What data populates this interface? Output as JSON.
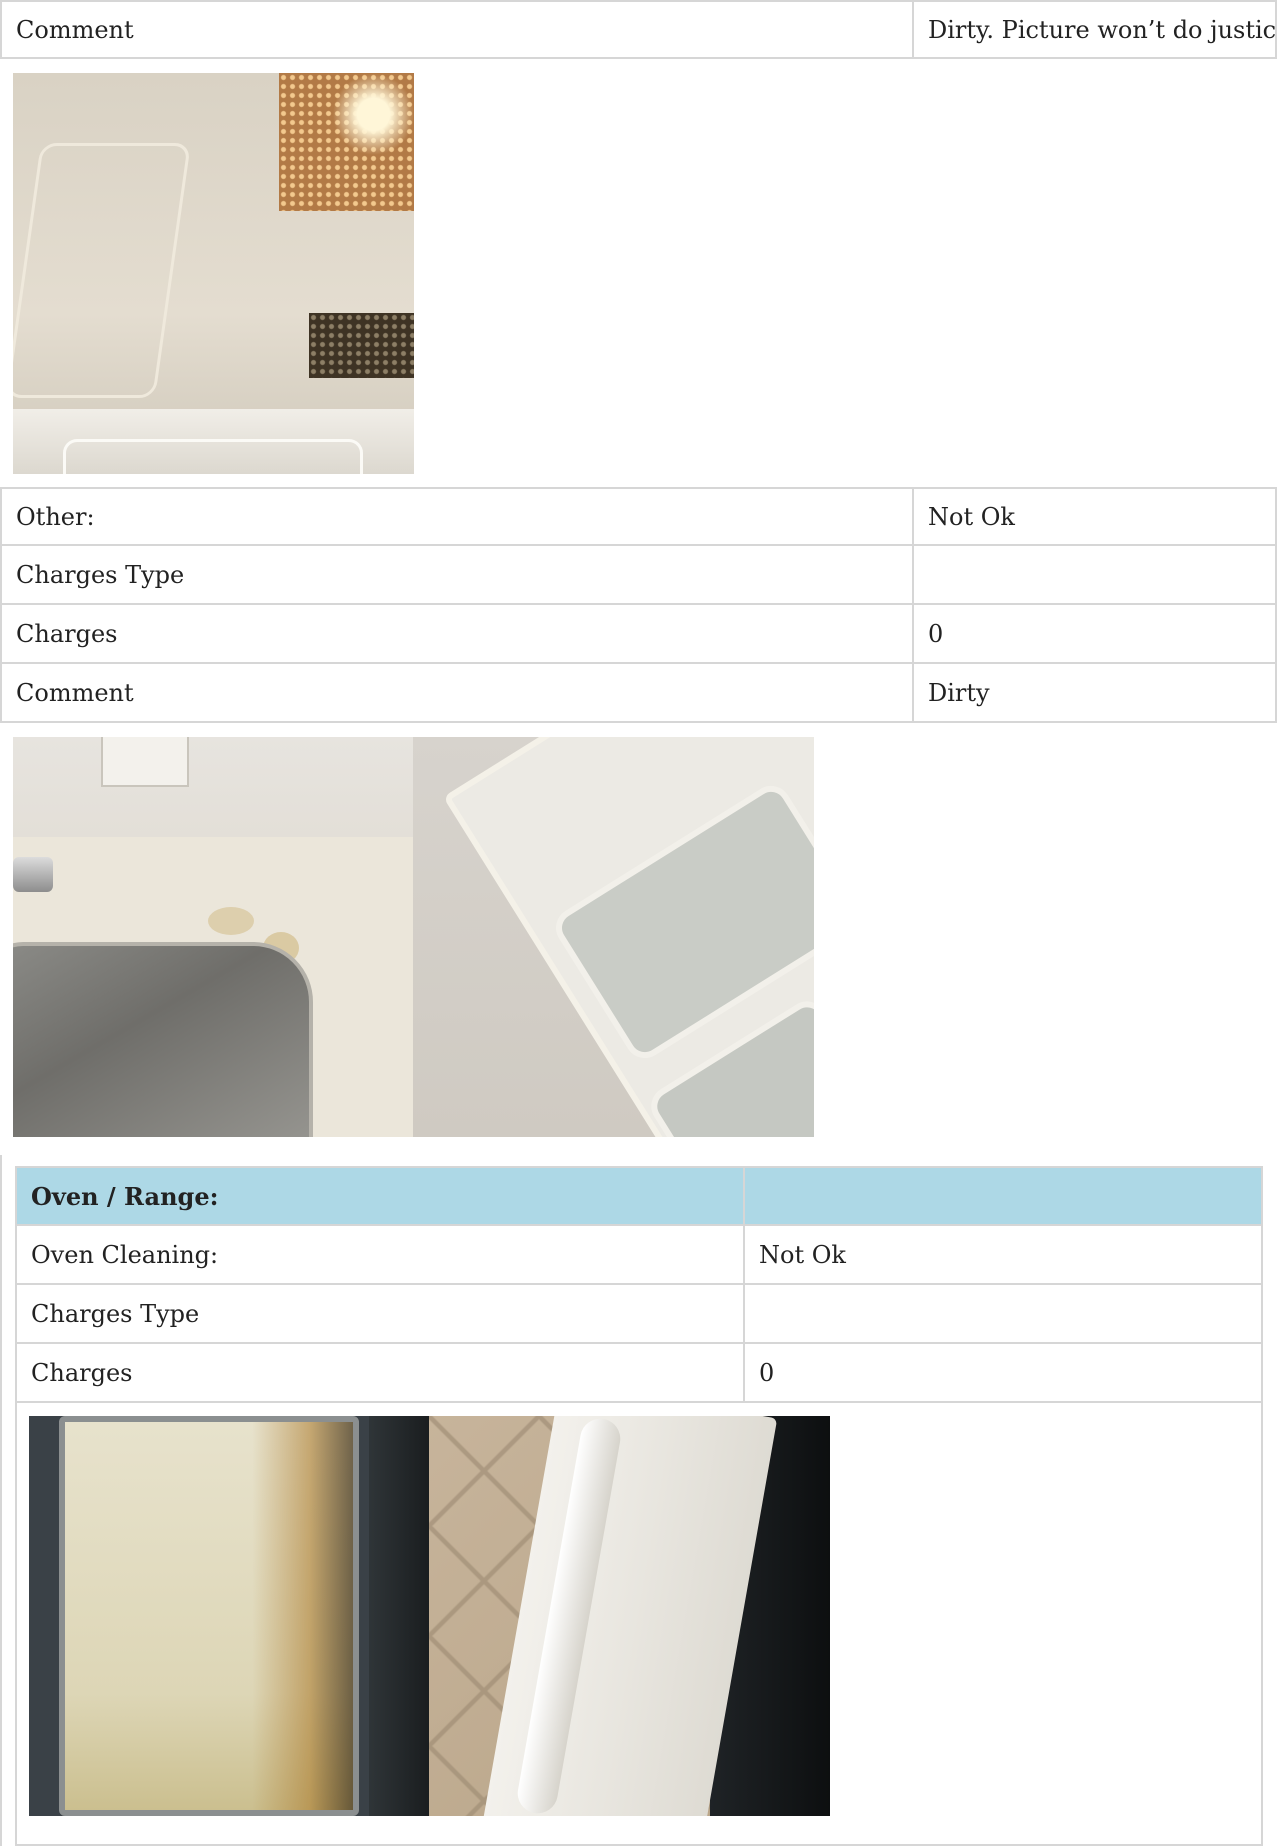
{
  "microwave": {
    "comment_label": "Comment",
    "comment_value": "Dirty. Picture won’t do justice."
  },
  "other": {
    "label": "Other:",
    "status": "Not Ok",
    "charges_type_label": "Charges Type",
    "charges_type_value": "",
    "charges_label": "Charges",
    "charges_value": "0",
    "comment_label": "Comment",
    "comment_value": "Dirty"
  },
  "oven": {
    "header_label": "Oven / Range:",
    "header_value": "",
    "cleaning_label": "Oven Cleaning:",
    "cleaning_status": "Not Ok",
    "charges_type_label": "Charges Type",
    "charges_type_value": "",
    "charges_label": "Charges",
    "charges_value": "0"
  },
  "colors": {
    "section_header_bg": "#add8e6",
    "border": "#d6d6d6"
  }
}
